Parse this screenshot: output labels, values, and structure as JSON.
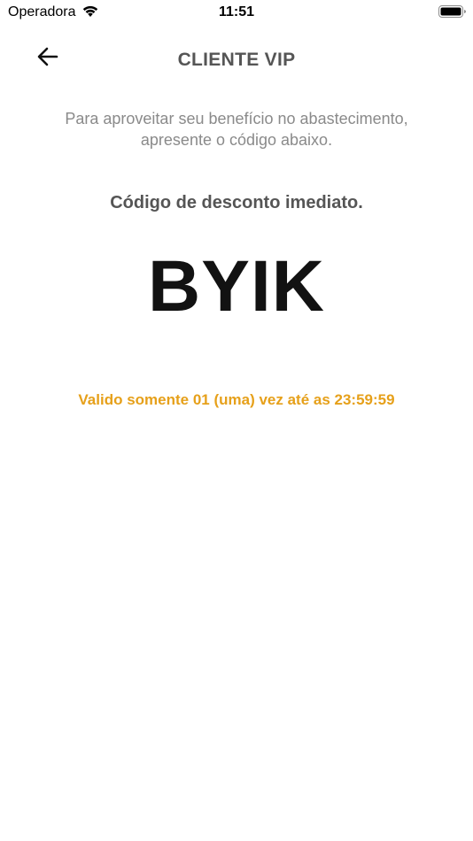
{
  "status_bar": {
    "carrier": "Operadora",
    "time": "11:51"
  },
  "header": {
    "title": "CLIENTE VIP",
    "back_icon": "arrow-left-icon"
  },
  "content": {
    "instructions_line1": "Para aproveitar seu benefício no abastecimento,",
    "instructions_line2": "apresente o código abaixo.",
    "code_heading": "Código de desconto imediato.",
    "code": "BYIK",
    "validity": "Valido somente 01 (uma) vez até as 23:59:59"
  },
  "colors": {
    "title": "#555555",
    "instructions": "#8a8a8a",
    "code": "#121212",
    "validity": "#e6a01a"
  }
}
